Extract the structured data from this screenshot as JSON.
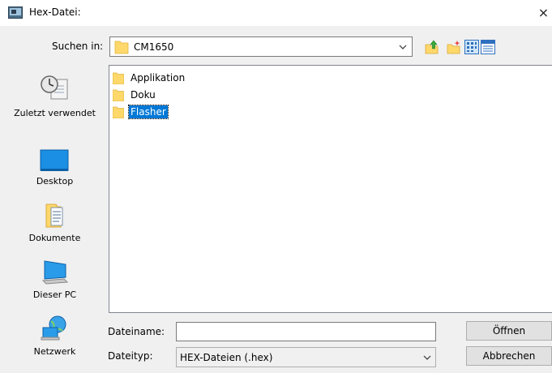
{
  "window": {
    "title": "Hex-Datei:",
    "close_glyph": "×"
  },
  "lookin": {
    "label": "Suchen in:",
    "value": "CM1650"
  },
  "toolbar": {
    "icons": [
      "up-folder-icon",
      "new-folder-icon",
      "view-menu-icon",
      "details-view-icon"
    ]
  },
  "places": [
    {
      "label": "Zuletzt verwendet",
      "icon": "recent-icon"
    },
    {
      "label": "Desktop",
      "icon": "desktop-icon"
    },
    {
      "label": "Dokumente",
      "icon": "documents-icon"
    },
    {
      "label": "Dieser PC",
      "icon": "computer-icon"
    },
    {
      "label": "Netzwerk",
      "icon": "network-icon"
    }
  ],
  "files": [
    {
      "name": "Applikation",
      "selected": false
    },
    {
      "name": "Doku",
      "selected": false
    },
    {
      "name": "Flasher",
      "selected": true
    }
  ],
  "filename": {
    "label": "Dateiname:",
    "value": "",
    "placeholder": ""
  },
  "filetype": {
    "label": "Dateityp:",
    "value": "HEX-Dateien (.hex)"
  },
  "buttons": {
    "open": "Öffnen",
    "cancel": "Abbrechen"
  },
  "colors": {
    "accent": "#0078d7",
    "folder": "#ffd86b",
    "dialog_bg": "#f0f0f0"
  }
}
